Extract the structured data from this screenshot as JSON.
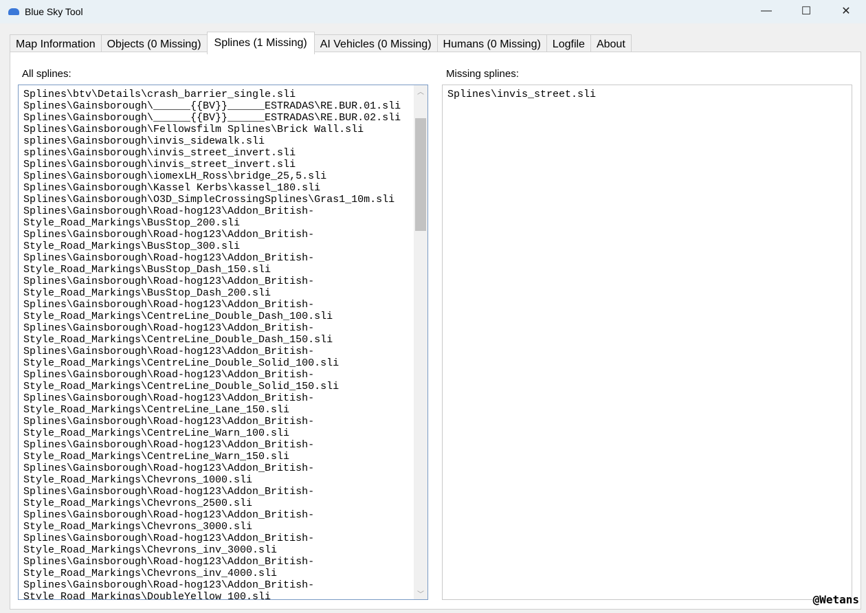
{
  "window": {
    "title": "Blue Sky Tool",
    "minimize": "—",
    "maximize": "☐",
    "close": "✕"
  },
  "tabs": [
    {
      "label": "Map Information"
    },
    {
      "label": "Objects (0 Missing)"
    },
    {
      "label": "Splines (1 Missing)",
      "active": true
    },
    {
      "label": "AI Vehicles (0 Missing)"
    },
    {
      "label": "Humans (0 Missing)"
    },
    {
      "label": "Logfile"
    },
    {
      "label": "About"
    }
  ],
  "all_splines": {
    "label": "All splines:",
    "items": [
      "Splines\\btv\\Details\\crash_barrier_single.sli",
      "Splines\\Gainsborough\\______{{BV}}______ESTRADAS\\RE.BUR.01.sli",
      "Splines\\Gainsborough\\______{{BV}}______ESTRADAS\\RE.BUR.02.sli",
      "Splines\\Gainsborough\\Fellowsfilm Splines\\Brick Wall.sli",
      "splines\\Gainsborough\\invis_sidewalk.sli",
      "splines\\Gainsborough\\invis_street_invert.sli",
      "Splines\\Gainsborough\\invis_street_invert.sli",
      "Splines\\Gainsborough\\iomexLH_Ross\\bridge_25,5.sli",
      "Splines\\Gainsborough\\Kassel Kerbs\\kassel_180.sli",
      "Splines\\Gainsborough\\O3D_SimpleCrossingSplines\\Gras1_10m.sli",
      "Splines\\Gainsborough\\Road-hog123\\Addon_British-Style_Road_Markings\\BusStop_200.sli",
      "Splines\\Gainsborough\\Road-hog123\\Addon_British-Style_Road_Markings\\BusStop_300.sli",
      "Splines\\Gainsborough\\Road-hog123\\Addon_British-Style_Road_Markings\\BusStop_Dash_150.sli",
      "Splines\\Gainsborough\\Road-hog123\\Addon_British-Style_Road_Markings\\BusStop_Dash_200.sli",
      "Splines\\Gainsborough\\Road-hog123\\Addon_British-Style_Road_Markings\\CentreLine_Double_Dash_100.sli",
      "Splines\\Gainsborough\\Road-hog123\\Addon_British-Style_Road_Markings\\CentreLine_Double_Dash_150.sli",
      "Splines\\Gainsborough\\Road-hog123\\Addon_British-Style_Road_Markings\\CentreLine_Double_Solid_100.sli",
      "Splines\\Gainsborough\\Road-hog123\\Addon_British-Style_Road_Markings\\CentreLine_Double_Solid_150.sli",
      "Splines\\Gainsborough\\Road-hog123\\Addon_British-Style_Road_Markings\\CentreLine_Lane_150.sli",
      "Splines\\Gainsborough\\Road-hog123\\Addon_British-Style_Road_Markings\\CentreLine_Warn_100.sli",
      "Splines\\Gainsborough\\Road-hog123\\Addon_British-Style_Road_Markings\\CentreLine_Warn_150.sli",
      "Splines\\Gainsborough\\Road-hog123\\Addon_British-Style_Road_Markings\\Chevrons_1000.sli",
      "Splines\\Gainsborough\\Road-hog123\\Addon_British-Style_Road_Markings\\Chevrons_2500.sli",
      "Splines\\Gainsborough\\Road-hog123\\Addon_British-Style_Road_Markings\\Chevrons_3000.sli",
      "Splines\\Gainsborough\\Road-hog123\\Addon_British-Style_Road_Markings\\Chevrons_inv_3000.sli",
      "Splines\\Gainsborough\\Road-hog123\\Addon_British-Style_Road_Markings\\Chevrons_inv_4000.sli",
      "Splines\\Gainsborough\\Road-hog123\\Addon_British-Style_Road_Markings\\DoubleYellow_100.sli"
    ]
  },
  "missing_splines": {
    "label": "Missing splines:",
    "items": [
      "Splines\\invis_street.sli"
    ]
  },
  "watermark": "@Wetans"
}
